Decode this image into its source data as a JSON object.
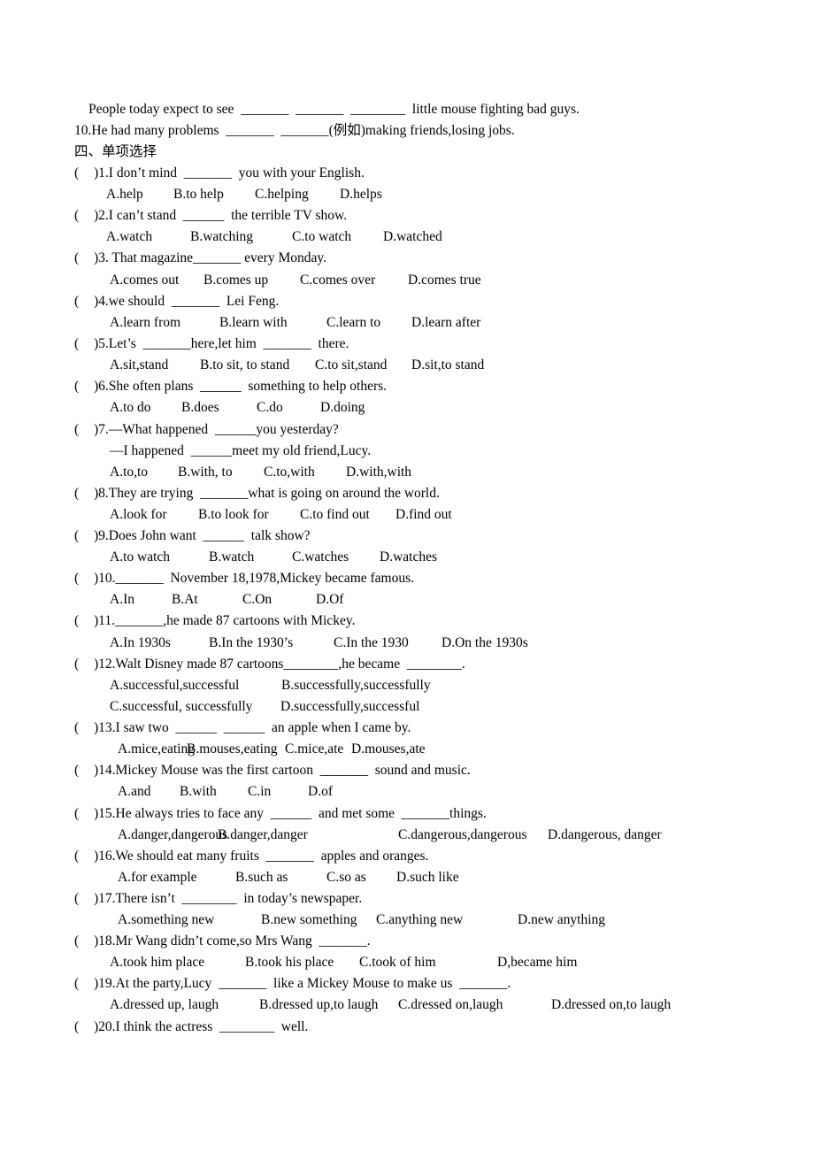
{
  "intro": [
    "People today expect to see  _______  _______  ________  little mouse fighting bad guys.",
    "10.He had many problems  _______  _______(例如)making friends,losing jobs."
  ],
  "section_title": "四、单项选择",
  "questions": [
    {
      "stem": ")1.I don’t mind  _______  you with your English.",
      "options": [
        "A.help",
        "B.to help",
        "C.helping",
        "D.helps"
      ]
    },
    {
      "stem": ")2.I can’t stand  ______  the terrible TV show.",
      "options": [
        "A.watch",
        "B.watching",
        "C.to watch",
        "D.watched"
      ]
    },
    {
      "stem": ")3. That magazine_______ every Monday.",
      "options": [
        "A.comes out",
        "B.comes up",
        "C.comes over",
        "D.comes true"
      ]
    },
    {
      "stem": ")4.we should  _______  Lei Feng.",
      "options": [
        "A.learn from",
        "B.learn with",
        "C.learn to",
        "D.learn after"
      ]
    },
    {
      "stem": ")5.Let’s  _______here,let him  _______  there.",
      "options": [
        "A.sit,stand",
        "B.to sit, to stand",
        "C.to sit,stand",
        "D.sit,to stand"
      ]
    },
    {
      "stem": ")6.She often plans  ______  something to help others.",
      "options": [
        "A.to do",
        "B.does",
        "C.do",
        "D.doing"
      ]
    },
    {
      "stem": ")7.—What happened  ______you yesterday?",
      "extra": "—I happened  ______meet my old friend,Lucy.",
      "options": [
        "A.to,to",
        "B.with, to",
        "C.to,with",
        "D.with,with"
      ]
    },
    {
      "stem": ")8.They are trying  _______what is going on around the world.",
      "options": [
        "A.look for",
        "B.to look for",
        "C.to find out",
        "D.find out"
      ]
    },
    {
      "stem": ")9.Does John want  ______  talk show?",
      "options": [
        "A.to watch",
        "B.watch",
        "C.watches",
        "D.watches"
      ]
    },
    {
      "stem": ")10._______  November 18,1978,Mickey became famous.",
      "options": [
        "A.In",
        "B.At",
        "C.On",
        "D.Of"
      ]
    },
    {
      "stem": ")11._______,he made 87 cartoons with Mickey.",
      "options": [
        "A.In 1930s",
        "B.In the 1930’s",
        "C.In the 1930",
        "D.On the 1930s"
      ]
    },
    {
      "stem": ")12.Walt Disney made 87 cartoons________,he became  ________.",
      "options": [
        "A.successful,successful",
        "B.successfully,successfully",
        "C.successful, successfully",
        "D.successfully,successful"
      ]
    },
    {
      "stem": ")13.I saw two  ______  ______  an apple when I came by.",
      "options": [
        "A.mice,eating",
        "B.mouses,eating",
        "C.mice,ate",
        "D.mouses,ate"
      ]
    },
    {
      "stem": ")14.Mickey Mouse was the first cartoon  _______  sound and music.",
      "options": [
        "A.and",
        "B.with",
        "C.in",
        "D.of"
      ]
    },
    {
      "stem": ")15.He always tries to face any  ______  and met some  _______things.",
      "options": [
        "A.danger,dangerous",
        "B.danger,danger",
        "C.dangerous,dangerous",
        "D.dangerous, danger"
      ]
    },
    {
      "stem": ")16.We should eat many fruits  _______  apples and oranges.",
      "options": [
        "A.for example",
        "B.such as",
        "C.so as",
        "D.such like"
      ]
    },
    {
      "stem": ")17.There isn’t  ________  in today’s newspaper.",
      "options": [
        "A.something new",
        "B.new something",
        "C.anything new",
        "D.new anything"
      ]
    },
    {
      "stem": ")18.Mr Wang didn’t come,so Mrs Wang  _______.",
      "options": [
        "A.took him place",
        "B.took his place",
        "C.took of him",
        "D,became him"
      ]
    },
    {
      "stem": ")19.At the party,Lucy  _______  like a Mickey Mouse to make us  _______.",
      "options": [
        "A.dressed up, laugh",
        "B.dressed up,to laugh",
        "C.dressed on,laugh",
        "D.dressed on,to laugh"
      ]
    },
    {
      "stem": ")20.I think the actress  ________  well."
    }
  ],
  "paren_open": "("
}
